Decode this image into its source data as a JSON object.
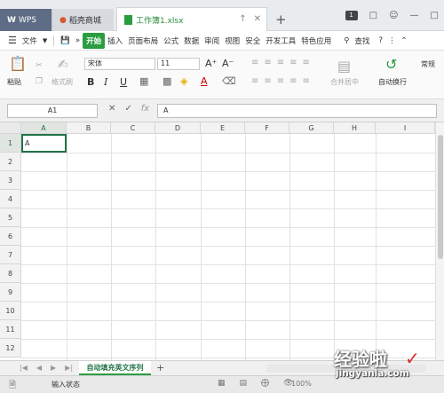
{
  "titlebar": {
    "wps_tab": "WPS",
    "store_tab": "稻壳商城",
    "doc_tab": "工作簿1.xlsx",
    "new_tab": "+",
    "badge": "1"
  },
  "menu": {
    "file": "文件",
    "start": "开始",
    "items": [
      "插入",
      "页面布局",
      "公式",
      "数据",
      "审阅",
      "视图",
      "安全",
      "开发工具",
      "特色应用"
    ],
    "search": "查找",
    "help": "?"
  },
  "ribbon": {
    "paste": "粘贴",
    "format_painter": "格式刷",
    "font_name": "宋体",
    "font_size": "11",
    "grow_font": "A⁺",
    "shrink_font": "A⁻",
    "bold": "B",
    "italic": "I",
    "underline": "U",
    "font_color": "A",
    "merge_center": "合并居中",
    "wrap_text": "自动换行",
    "number_format": "常规"
  },
  "formula_bar": {
    "name_box": "A1",
    "cancel": "✕",
    "confirm": "✓",
    "fx": "fx",
    "value": "A"
  },
  "grid": {
    "columns": [
      "A",
      "B",
      "C",
      "D",
      "E",
      "F",
      "G",
      "H",
      "I"
    ],
    "rows": [
      "1",
      "2",
      "3",
      "4",
      "5",
      "6",
      "7",
      "8",
      "9",
      "10",
      "11",
      "12"
    ],
    "active_cell_value": "A"
  },
  "sheets": {
    "active": "自动填充英文序列",
    "add": "+"
  },
  "status": {
    "mode": "输入状态",
    "zoom": "100%"
  },
  "watermark": {
    "title": "经验啦",
    "url": "jingyanla.com"
  },
  "colors": {
    "accent": "#2a9d41",
    "selection_border": "#217346"
  }
}
